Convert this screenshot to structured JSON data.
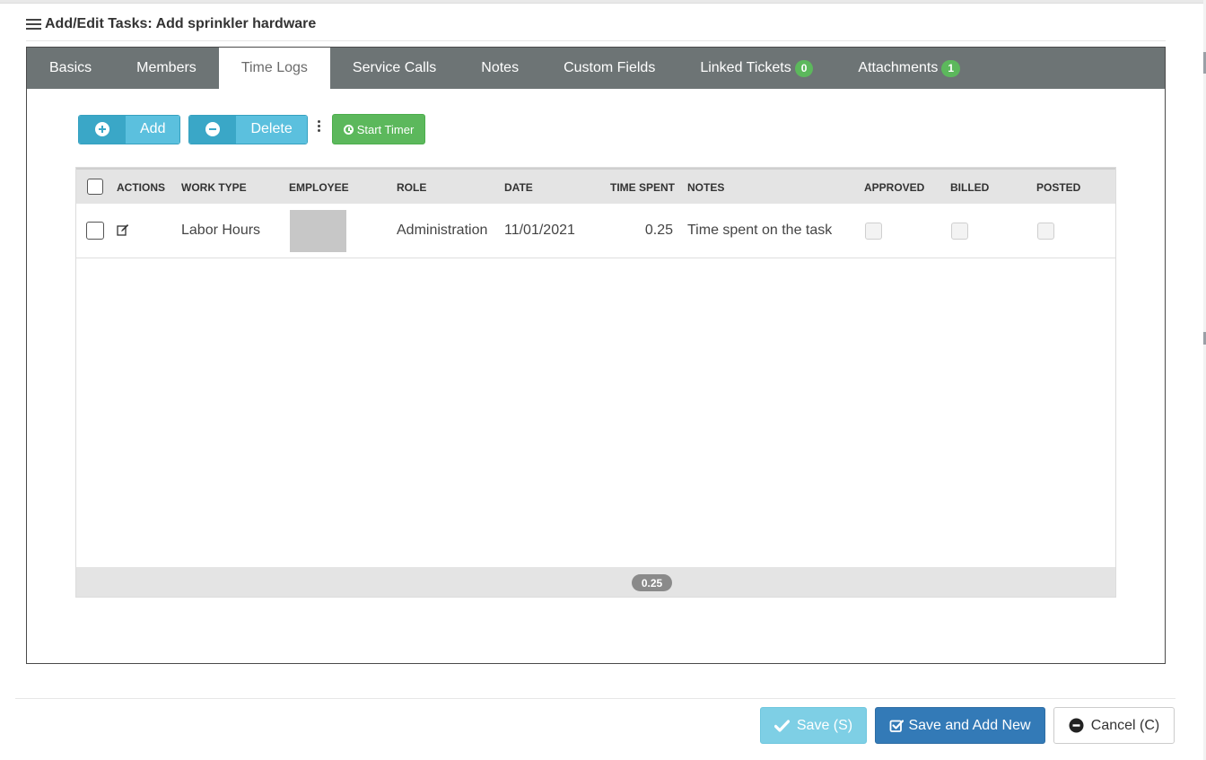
{
  "modal": {
    "title": "Add/Edit Tasks: Add sprinkler hardware"
  },
  "tabs": [
    {
      "label": "Basics"
    },
    {
      "label": "Members"
    },
    {
      "label": "Time Logs",
      "active": true
    },
    {
      "label": "Service Calls"
    },
    {
      "label": "Notes"
    },
    {
      "label": "Custom Fields"
    },
    {
      "label": "Linked Tickets",
      "badge": "0"
    },
    {
      "label": "Attachments",
      "badge": "1"
    }
  ],
  "toolbar": {
    "add_label": "Add",
    "delete_label": "Delete",
    "start_timer_label": "Start Timer"
  },
  "grid": {
    "columns": {
      "actions": "ACTIONS",
      "work_type": "WORK TYPE",
      "employee": "EMPLOYEE",
      "role": "ROLE",
      "date": "DATE",
      "time_spent": "TIME SPENT",
      "notes": "NOTES",
      "approved": "APPROVED",
      "billed": "BILLED",
      "posted": "POSTED"
    },
    "rows": [
      {
        "work_type": "Labor Hours",
        "employee": "",
        "role": "Administration",
        "date": "11/01/2021",
        "time_spent": "0.25",
        "notes": "Time spent on the task",
        "approved": false,
        "billed": false,
        "posted": false
      }
    ],
    "total_time_spent": "0.25"
  },
  "footer": {
    "save_label": "Save (S)",
    "save_add_new_label": "Save and Add New",
    "cancel_label": "Cancel (C)"
  },
  "colors": {
    "tab_bar": "#6d7475",
    "info": "#5bc0de",
    "success": "#5cb85c",
    "primary": "#337ab7"
  }
}
